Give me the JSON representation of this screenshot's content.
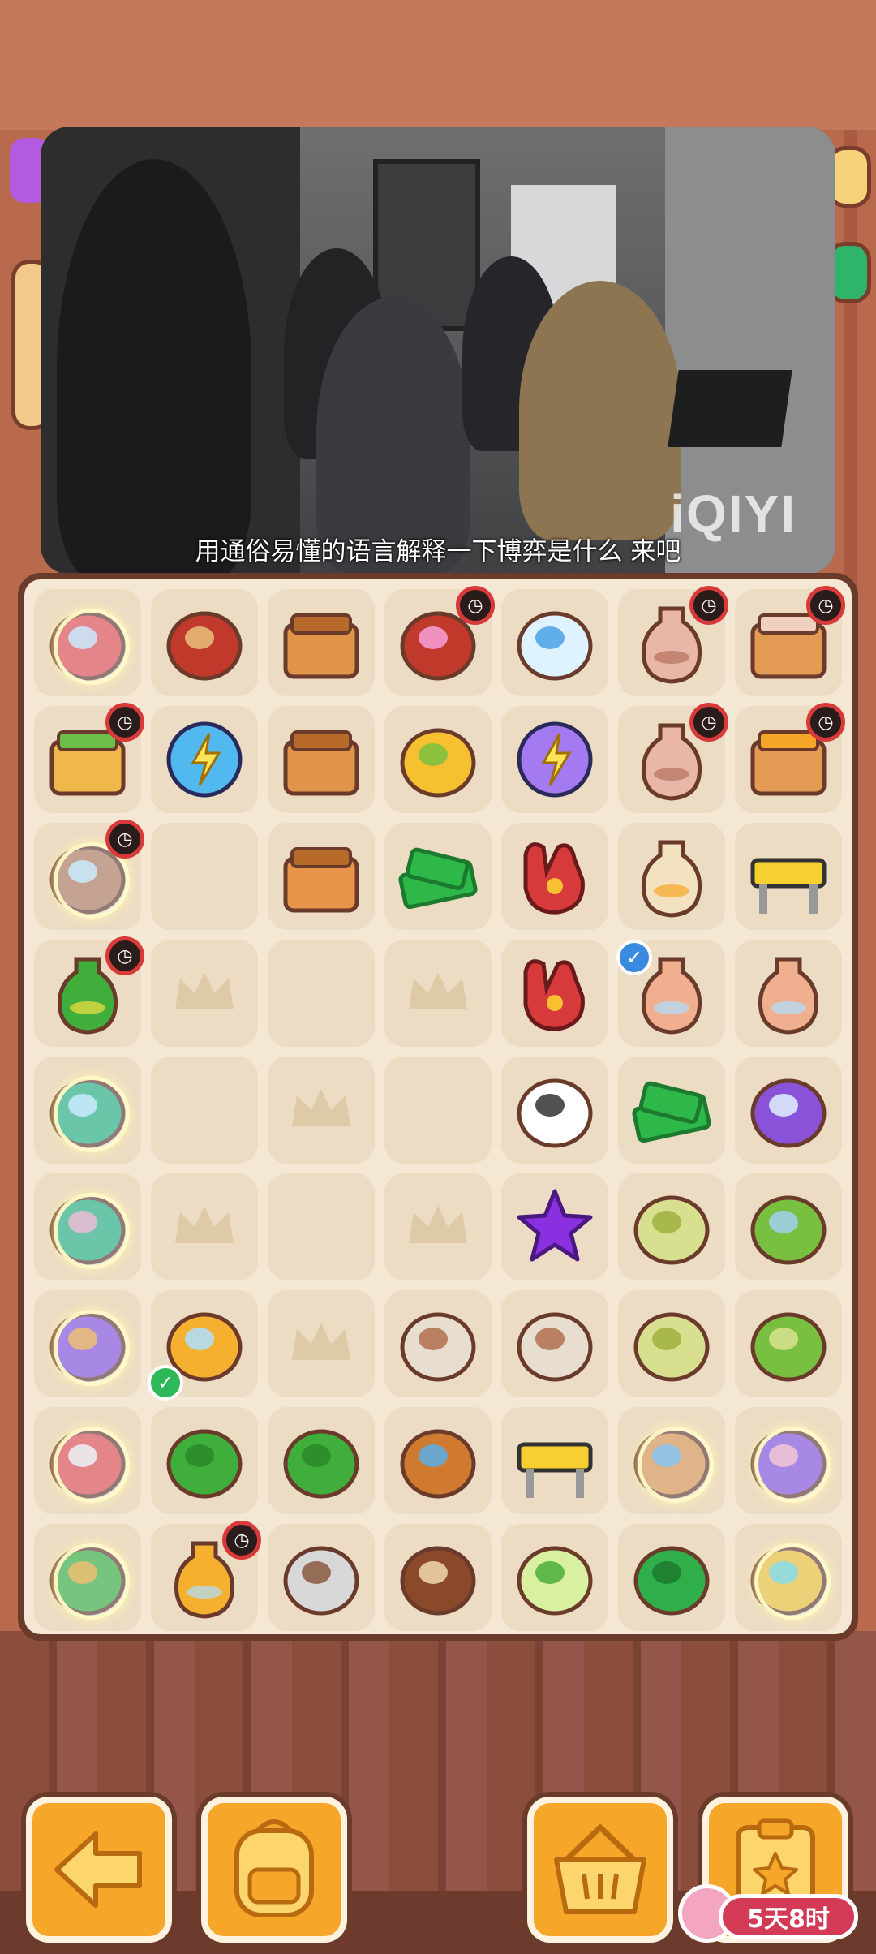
{
  "video": {
    "subtitle": "用通俗易懂的语言解释一下博弈是什么 来吧",
    "watermark": "iQIYI"
  },
  "timer": {
    "label": "5天8时"
  },
  "grid": {
    "rows": 9,
    "cols": 7,
    "items": [
      [
        "toolbox-crystal-ball",
        "broom",
        "cardboard-boxes",
        "candy-tv",
        "thermometer",
        "clay-pot",
        "treasure-chest"
      ],
      [
        "gift-box",
        "energy-orb",
        "flat-boxes",
        "gold-coin-pouch",
        "energy-orb-large",
        "vase",
        "open-chest"
      ],
      [
        "tea-pot-crystal",
        "empty",
        "package",
        "cash-stack",
        "red-gloves",
        "striped-vase",
        "barrier-sign"
      ],
      [
        "potted-tree",
        "empty-plain",
        "empty",
        "empty-plain",
        "red-gloves",
        "glass-vase",
        "glass-vase-tall"
      ],
      [
        "mint-crystal",
        "empty",
        "empty-plain",
        "empty",
        "panda-badge",
        "cash-bundle",
        "purple-scooter"
      ],
      [
        "tree-crystal",
        "empty-plain",
        "empty",
        "empty-plain",
        "purple-star",
        "bread-roll",
        "green-cake"
      ],
      [
        "magic-crystal",
        "yellow-glasses",
        "empty-plain",
        "evidence-bag",
        "evidence-bag-2",
        "shanghai-soap",
        "green-soap"
      ],
      [
        "gift-crystal",
        "sprout",
        "leaf-plant",
        "magnifier",
        "road-barrier",
        "map-crystal",
        "car-crystal"
      ],
      [
        "plant-crystal",
        "pot-with-ice",
        "scale-evidence",
        "footprints",
        "soap-bottle",
        "green-bottle",
        "gold-box-crystal"
      ]
    ],
    "clock_badges": [
      [
        0,
        3
      ],
      [
        0,
        5
      ],
      [
        0,
        6
      ],
      [
        1,
        0
      ],
      [
        1,
        5
      ],
      [
        1,
        6
      ],
      [
        2,
        0
      ],
      [
        3,
        0
      ],
      [
        8,
        1
      ]
    ],
    "check_badges": [
      [
        3,
        5
      ],
      [
        6,
        1
      ]
    ]
  },
  "bottom_bar": {
    "buttons": [
      "back-arrow-icon",
      "backpack-icon",
      "basket-icon",
      "clipboard-star-icon"
    ]
  },
  "colors": {
    "board_bg": "#f4e7d3",
    "cell_bg": "#ecdcc4",
    "button_orange": "#f6a628",
    "frame_brown": "#6a3a2b",
    "timer_pink": "#d23a56"
  }
}
